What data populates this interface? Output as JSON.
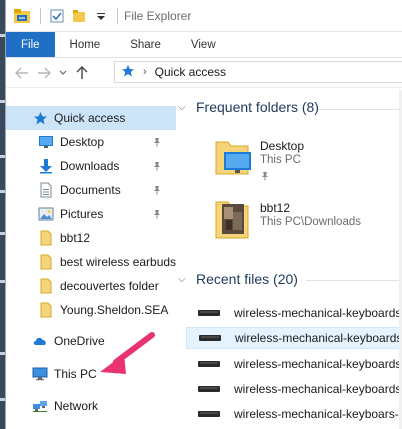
{
  "titlebar": {
    "title": "File Explorer"
  },
  "ribbon": {
    "tabs": [
      "File",
      "Home",
      "Share",
      "View"
    ]
  },
  "address": {
    "location": "Quick access"
  },
  "nav": {
    "items": [
      {
        "label": "Quick access",
        "icon": "star-icon",
        "level": 0,
        "selected": true
      },
      {
        "label": "Desktop",
        "icon": "desktop-folder-icon",
        "level": 1,
        "pinned": true
      },
      {
        "label": "Downloads",
        "icon": "download-arrow-icon",
        "level": 1,
        "pinned": true
      },
      {
        "label": "Documents",
        "icon": "documents-folder-icon",
        "level": 1,
        "pinned": true
      },
      {
        "label": "Pictures",
        "icon": "pictures-folder-icon",
        "level": 1,
        "pinned": true
      },
      {
        "label": "bbt12",
        "icon": "folder-icon",
        "level": 1
      },
      {
        "label": "best wireless earbuds",
        "icon": "folder-icon",
        "level": 1
      },
      {
        "label": "decouvertes folder",
        "icon": "folder-icon",
        "level": 1
      },
      {
        "label": "Young.Sheldon.SEA",
        "icon": "folder-icon",
        "level": 1
      },
      {
        "label": "OneDrive",
        "icon": "cloud-icon",
        "level": 0
      },
      {
        "label": "This PC",
        "icon": "computer-icon",
        "level": 0
      },
      {
        "label": "Network",
        "icon": "network-icon",
        "level": 0
      }
    ]
  },
  "content": {
    "frequent": {
      "header": "Frequent folders (8)",
      "folders": [
        {
          "name": "Desktop",
          "location": "This PC",
          "pinned": true
        },
        {
          "name": "bbt12",
          "location": "This PC\\Downloads",
          "pinned": false
        }
      ]
    },
    "recent": {
      "header": "Recent files (20)",
      "files": [
        {
          "name": "wireless-mechanical-keyboards-",
          "selected": false
        },
        {
          "name": "wireless-mechanical-keyboards-",
          "selected": true
        },
        {
          "name": "wireless-mechanical-keyboards-",
          "selected": false
        },
        {
          "name": "wireless-mechanical-keyboards-",
          "selected": false
        },
        {
          "name": "wireless-mechanical-keyboars-V",
          "selected": false
        }
      ]
    }
  },
  "colors": {
    "file_tab": "#1f6fc5",
    "selected_nav": "#cce4f7",
    "annotation_arrow": "#e8336f"
  }
}
